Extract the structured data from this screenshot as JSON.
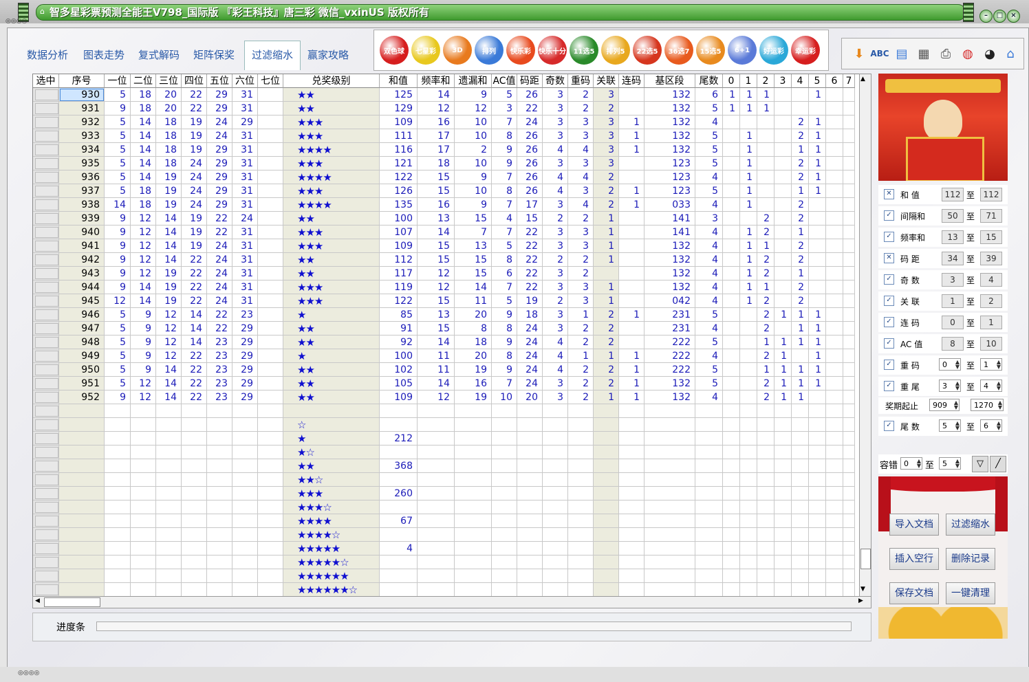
{
  "window": {
    "title": "智多星彩票预测全能王V798_国际版 『彩王科技』唐三彩 微信_vxinUS 版权所有"
  },
  "tabs": [
    {
      "label": "数据分析",
      "active": false
    },
    {
      "label": "图表走势",
      "active": false
    },
    {
      "label": "复式解码",
      "active": false
    },
    {
      "label": "矩阵保奖",
      "active": false
    },
    {
      "label": "过滤缩水",
      "active": true
    },
    {
      "label": "赢家攻略",
      "active": false
    }
  ],
  "lottery_icons": [
    {
      "name": "双色球",
      "color": "#d61e1e"
    },
    {
      "name": "七星彩",
      "color": "#e8c81e"
    },
    {
      "name": "3D",
      "color": "#e87a1e"
    },
    {
      "name": "排列",
      "color": "#3a7ad8"
    },
    {
      "name": "快乐彩",
      "color": "#e84a1e"
    },
    {
      "name": "快乐十分",
      "color": "#d62a2a"
    },
    {
      "name": "11选5",
      "color": "#2a8a2a"
    },
    {
      "name": "排列5",
      "color": "#e8a81e"
    },
    {
      "name": "22选5",
      "color": "#d6361e"
    },
    {
      "name": "36选7",
      "color": "#e85a1e"
    },
    {
      "name": "15选5",
      "color": "#e88a1e"
    },
    {
      "name": "6+1",
      "color": "#5a7ad8"
    },
    {
      "name": "好运彩",
      "color": "#2aa8d8"
    },
    {
      "name": "幸运彩",
      "color": "#d61e1e"
    }
  ],
  "grid": {
    "columns": [
      "选中",
      "序号",
      "一位",
      "二位",
      "三位",
      "四位",
      "五位",
      "六位",
      "七位",
      "兑奖级别",
      "和值",
      "频率和",
      "遗漏和",
      "AC值",
      "码距",
      "奇数",
      "重码",
      "关联",
      "连码",
      "基区段",
      "尾数",
      "0",
      "1",
      "2",
      "3",
      "4",
      "5",
      "6",
      "7"
    ],
    "rows": [
      [
        "930",
        "5",
        "18",
        "20",
        "22",
        "29",
        "31",
        "",
        "★★",
        "125",
        "14",
        "9",
        "5",
        "26",
        "3",
        "2",
        "3",
        "",
        "132",
        "6",
        "1",
        "1",
        "1",
        "",
        "",
        "1",
        "",
        ""
      ],
      [
        "931",
        "9",
        "18",
        "20",
        "22",
        "29",
        "31",
        "",
        "★★",
        "129",
        "12",
        "12",
        "3",
        "22",
        "3",
        "2",
        "2",
        "",
        "132",
        "5",
        "1",
        "1",
        "1",
        "",
        "",
        "",
        "",
        ""
      ],
      [
        "932",
        "5",
        "14",
        "18",
        "19",
        "24",
        "29",
        "",
        "★★★",
        "109",
        "16",
        "10",
        "7",
        "24",
        "3",
        "3",
        "3",
        "1",
        "132",
        "4",
        "",
        "",
        "",
        "",
        "2",
        "1",
        "",
        ""
      ],
      [
        "933",
        "5",
        "14",
        "18",
        "19",
        "24",
        "31",
        "",
        "★★★",
        "111",
        "17",
        "10",
        "8",
        "26",
        "3",
        "3",
        "3",
        "1",
        "132",
        "5",
        "",
        "1",
        "",
        "",
        "2",
        "1",
        "",
        ""
      ],
      [
        "934",
        "5",
        "14",
        "18",
        "19",
        "29",
        "31",
        "",
        "★★★★",
        "116",
        "17",
        "2",
        "9",
        "26",
        "4",
        "4",
        "3",
        "1",
        "132",
        "5",
        "",
        "1",
        "",
        "",
        "1",
        "1",
        "",
        ""
      ],
      [
        "935",
        "5",
        "14",
        "18",
        "24",
        "29",
        "31",
        "",
        "★★★",
        "121",
        "18",
        "10",
        "9",
        "26",
        "3",
        "3",
        "3",
        "",
        "123",
        "5",
        "",
        "1",
        "",
        "",
        "2",
        "1",
        "",
        ""
      ],
      [
        "936",
        "5",
        "14",
        "19",
        "24",
        "29",
        "31",
        "",
        "★★★★",
        "122",
        "15",
        "9",
        "7",
        "26",
        "4",
        "4",
        "2",
        "",
        "123",
        "4",
        "",
        "1",
        "",
        "",
        "2",
        "1",
        "",
        ""
      ],
      [
        "937",
        "5",
        "18",
        "19",
        "24",
        "29",
        "31",
        "",
        "★★★",
        "126",
        "15",
        "10",
        "8",
        "26",
        "4",
        "3",
        "2",
        "1",
        "123",
        "5",
        "",
        "1",
        "",
        "",
        "1",
        "1",
        "",
        ""
      ],
      [
        "938",
        "14",
        "18",
        "19",
        "24",
        "29",
        "31",
        "",
        "★★★★",
        "135",
        "16",
        "9",
        "7",
        "17",
        "3",
        "4",
        "2",
        "1",
        "033",
        "4",
        "",
        "1",
        "",
        "",
        "2",
        "",
        "",
        ""
      ],
      [
        "939",
        "9",
        "12",
        "14",
        "19",
        "22",
        "24",
        "",
        "★★",
        "100",
        "13",
        "15",
        "4",
        "15",
        "2",
        "2",
        "1",
        "",
        "141",
        "3",
        "",
        "",
        "2",
        "",
        "2",
        "",
        "",
        ""
      ],
      [
        "940",
        "9",
        "12",
        "14",
        "19",
        "22",
        "31",
        "",
        "★★★",
        "107",
        "14",
        "7",
        "7",
        "22",
        "3",
        "3",
        "1",
        "",
        "141",
        "4",
        "",
        "1",
        "2",
        "",
        "1",
        "",
        "",
        ""
      ],
      [
        "941",
        "9",
        "12",
        "14",
        "19",
        "24",
        "31",
        "",
        "★★★",
        "109",
        "15",
        "13",
        "5",
        "22",
        "3",
        "3",
        "1",
        "",
        "132",
        "4",
        "",
        "1",
        "1",
        "",
        "2",
        "",
        "",
        ""
      ],
      [
        "942",
        "9",
        "12",
        "14",
        "22",
        "24",
        "31",
        "",
        "★★",
        "112",
        "15",
        "15",
        "8",
        "22",
        "2",
        "2",
        "1",
        "",
        "132",
        "4",
        "",
        "1",
        "2",
        "",
        "2",
        "",
        "",
        ""
      ],
      [
        "943",
        "9",
        "12",
        "19",
        "22",
        "24",
        "31",
        "",
        "★★",
        "117",
        "12",
        "15",
        "6",
        "22",
        "3",
        "2",
        "",
        "",
        "132",
        "4",
        "",
        "1",
        "2",
        "",
        "1",
        "",
        "",
        ""
      ],
      [
        "944",
        "9",
        "14",
        "19",
        "22",
        "24",
        "31",
        "",
        "★★★",
        "119",
        "12",
        "14",
        "7",
        "22",
        "3",
        "3",
        "1",
        "",
        "132",
        "4",
        "",
        "1",
        "1",
        "",
        "2",
        "",
        "",
        ""
      ],
      [
        "945",
        "12",
        "14",
        "19",
        "22",
        "24",
        "31",
        "",
        "★★★",
        "122",
        "15",
        "11",
        "5",
        "19",
        "2",
        "3",
        "1",
        "",
        "042",
        "4",
        "",
        "1",
        "2",
        "",
        "2",
        "",
        "",
        ""
      ],
      [
        "946",
        "5",
        "9",
        "12",
        "14",
        "22",
        "23",
        "",
        "★",
        "85",
        "13",
        "20",
        "9",
        "18",
        "3",
        "1",
        "2",
        "1",
        "231",
        "5",
        "",
        "",
        "2",
        "1",
        "1",
        "1",
        "",
        ""
      ],
      [
        "947",
        "5",
        "9",
        "12",
        "14",
        "22",
        "29",
        "",
        "★★",
        "91",
        "15",
        "8",
        "8",
        "24",
        "3",
        "2",
        "2",
        "",
        "231",
        "4",
        "",
        "",
        "2",
        "",
        "1",
        "1",
        "",
        ""
      ],
      [
        "948",
        "5",
        "9",
        "12",
        "14",
        "23",
        "29",
        "",
        "★★",
        "92",
        "14",
        "18",
        "9",
        "24",
        "4",
        "2",
        "2",
        "",
        "222",
        "5",
        "",
        "",
        "1",
        "1",
        "1",
        "1",
        "",
        ""
      ],
      [
        "949",
        "5",
        "9",
        "12",
        "22",
        "23",
        "29",
        "",
        "★",
        "100",
        "11",
        "20",
        "8",
        "24",
        "4",
        "1",
        "1",
        "1",
        "222",
        "4",
        "",
        "",
        "2",
        "1",
        "",
        "1",
        "",
        ""
      ],
      [
        "950",
        "5",
        "9",
        "14",
        "22",
        "23",
        "29",
        "",
        "★★",
        "102",
        "11",
        "19",
        "9",
        "24",
        "4",
        "2",
        "2",
        "1",
        "222",
        "5",
        "",
        "",
        "1",
        "1",
        "1",
        "1",
        "",
        ""
      ],
      [
        "951",
        "5",
        "12",
        "14",
        "22",
        "23",
        "29",
        "",
        "★★",
        "105",
        "14",
        "16",
        "7",
        "24",
        "3",
        "2",
        "2",
        "1",
        "132",
        "5",
        "",
        "",
        "2",
        "1",
        "1",
        "1",
        "",
        ""
      ],
      [
        "952",
        "9",
        "12",
        "14",
        "22",
        "23",
        "29",
        "",
        "★★",
        "109",
        "12",
        "19",
        "10",
        "20",
        "3",
        "2",
        "1",
        "1",
        "132",
        "4",
        "",
        "",
        "2",
        "1",
        "1",
        "",
        "",
        ""
      ]
    ],
    "level_summary": [
      {
        "level": "",
        "count": ""
      },
      {
        "level": "☆",
        "count": ""
      },
      {
        "level": "★",
        "count": "212"
      },
      {
        "level": "★☆",
        "count": ""
      },
      {
        "level": "★★",
        "count": "368"
      },
      {
        "level": "★★☆",
        "count": ""
      },
      {
        "level": "★★★",
        "count": "260"
      },
      {
        "level": "★★★☆",
        "count": ""
      },
      {
        "level": "★★★★",
        "count": "67"
      },
      {
        "level": "★★★★☆",
        "count": ""
      },
      {
        "level": "★★★★★",
        "count": "4"
      },
      {
        "level": "★★★★★☆",
        "count": ""
      },
      {
        "level": "★★★★★★",
        "count": ""
      },
      {
        "level": "★★★★★★☆",
        "count": ""
      }
    ]
  },
  "progress": {
    "label": "进度条"
  },
  "filters": [
    {
      "label": "和 值",
      "checked": false,
      "from": "112",
      "to": "112",
      "type": "box"
    },
    {
      "label": "间隔和",
      "checked": true,
      "from": "50",
      "to": "71",
      "type": "box"
    },
    {
      "label": "频率和",
      "checked": true,
      "from": "13",
      "to": "15",
      "type": "box"
    },
    {
      "label": "码 距",
      "checked": false,
      "from": "34",
      "to": "39",
      "type": "box"
    },
    {
      "label": "奇 数",
      "checked": true,
      "from": "3",
      "to": "4",
      "type": "box"
    },
    {
      "label": "关 联",
      "checked": true,
      "from": "1",
      "to": "2",
      "type": "box"
    },
    {
      "label": "连 码",
      "checked": true,
      "from": "0",
      "to": "1",
      "type": "box"
    },
    {
      "label": "AC 值",
      "checked": true,
      "from": "8",
      "to": "10",
      "type": "box"
    },
    {
      "label": "重 码",
      "checked": true,
      "from": "0",
      "to": "1",
      "type": "spin"
    },
    {
      "label": "重 尾",
      "checked": true,
      "from": "3",
      "to": "4",
      "type": "spin"
    },
    {
      "label": "尾 数",
      "checked": true,
      "from": "5",
      "to": "6",
      "type": "spin"
    }
  ],
  "range_word": "至",
  "period": {
    "label": "奖期起止",
    "from": "909",
    "to": "1270"
  },
  "tolerance": {
    "label": "容错",
    "from": "0",
    "to": "5"
  },
  "actions": [
    "导入文档",
    "过滤缩水",
    "插入空行",
    "删除记录",
    "保存文档",
    "一键清理"
  ]
}
